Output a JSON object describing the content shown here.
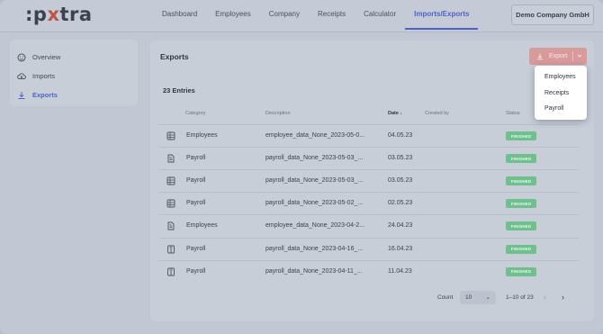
{
  "logo": {
    "part1": ":p",
    "x": "x",
    "part2": "tra"
  },
  "nav": {
    "items": [
      "Dashboard",
      "Employees",
      "Company",
      "Receipts",
      "Calculator",
      "Imports/Exports"
    ],
    "active": "Imports/Exports"
  },
  "company": "Demo Company GmbH",
  "sidebar": {
    "items": [
      {
        "label": "Overview",
        "icon": "overview-icon"
      },
      {
        "label": "Imports",
        "icon": "cloud-upload-icon"
      },
      {
        "label": "Exports",
        "icon": "download-icon",
        "active": true
      }
    ]
  },
  "panel": {
    "title": "Exports",
    "export_button": "Export",
    "entries": "23 Entries"
  },
  "table": {
    "headers": {
      "category": "Category",
      "description": "Description",
      "date": "Date",
      "created_by": "Created by",
      "status": "Status"
    },
    "rows": [
      {
        "icon": "spreadsheet-icon",
        "category": "Employees",
        "description": "employee_data_None_2023-05-0...",
        "date": "04.05.23",
        "created_by": "",
        "status": "FINISHED"
      },
      {
        "icon": "document-icon",
        "category": "Payroll",
        "description": "payroll_data_None_2023-05-03_...",
        "date": "03.05.23",
        "created_by": "",
        "status": "FINISHED"
      },
      {
        "icon": "spreadsheet-icon",
        "category": "Payroll",
        "description": "payroll_data_None_2023-05-03_...",
        "date": "03.05.23",
        "created_by": "",
        "status": "FINISHED"
      },
      {
        "icon": "spreadsheet-icon",
        "category": "Payroll",
        "description": "payroll_data_None_2023-05-02_...",
        "date": "02.05.23",
        "created_by": "",
        "status": "FINISHED"
      },
      {
        "icon": "document-icon",
        "category": "Employees",
        "description": "employee_data_None_2023-04-2...",
        "date": "24.04.23",
        "created_by": "",
        "status": "FINISHED"
      },
      {
        "icon": "column-file-icon",
        "category": "Payroll",
        "description": "payroll_data_None_2023-04-16_...",
        "date": "16.04.23",
        "created_by": "",
        "status": "FINISHED"
      },
      {
        "icon": "column-file-icon",
        "category": "Payroll",
        "description": "payroll_data_None_2023-04-11_...",
        "date": "11.04.23",
        "created_by": "",
        "status": "FINISHED"
      }
    ]
  },
  "pager": {
    "count_label": "Count",
    "count_value": "10",
    "range": "1–10 of 23"
  },
  "dropdown": {
    "items": [
      "Employees",
      "Receipts",
      "Payroll"
    ]
  },
  "colors": {
    "accent": "#4f63c6",
    "export": "#d99a9b",
    "status": "#6fc08e"
  }
}
